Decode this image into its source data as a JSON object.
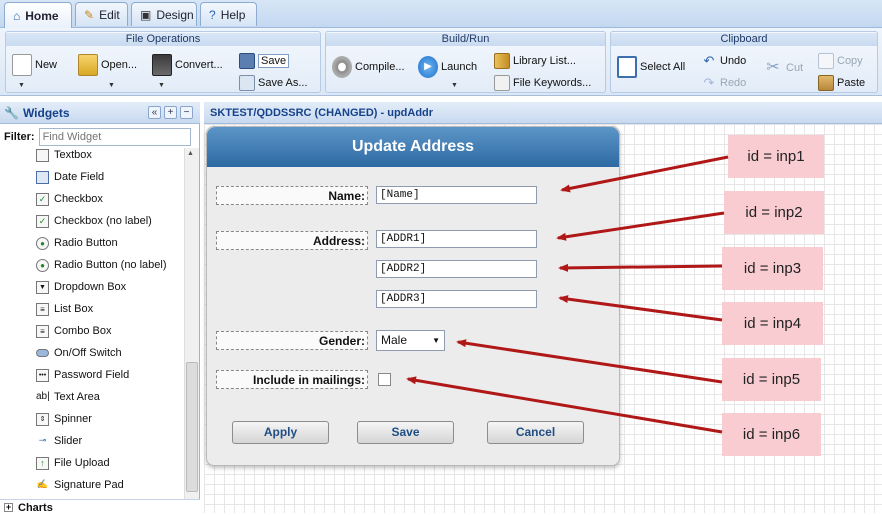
{
  "tabs": [
    {
      "label": "Home"
    },
    {
      "label": "Edit"
    },
    {
      "label": "Design"
    },
    {
      "label": "Help"
    }
  ],
  "ribbon": {
    "file_ops": {
      "title": "File Operations",
      "new": "New",
      "open": "Open...",
      "convert": "Convert...",
      "save": "Save",
      "save_as": "Save As..."
    },
    "build_run": {
      "title": "Build/Run",
      "compile": "Compile...",
      "launch": "Launch",
      "library_list": "Library List...",
      "file_keywords": "File Keywords..."
    },
    "clipboard": {
      "title": "Clipboard",
      "select_all": "Select All",
      "undo": "Undo",
      "redo": "Redo",
      "cut": "Cut",
      "copy": "Copy",
      "paste": "Paste"
    }
  },
  "sidebar": {
    "title": "Widgets",
    "filter_label": "Filter:",
    "filter_placeholder": "Find Widget",
    "items": [
      {
        "label": "Textbox"
      },
      {
        "label": "Date Field"
      },
      {
        "label": "Checkbox"
      },
      {
        "label": "Checkbox (no label)"
      },
      {
        "label": "Radio Button"
      },
      {
        "label": "Radio Button (no label)"
      },
      {
        "label": "Dropdown Box"
      },
      {
        "label": "List Box"
      },
      {
        "label": "Combo Box"
      },
      {
        "label": "On/Off Switch"
      },
      {
        "label": "Password Field"
      },
      {
        "label": "Text Area"
      },
      {
        "label": "Spinner"
      },
      {
        "label": "Slider"
      },
      {
        "label": "File Upload"
      },
      {
        "label": "Signature Pad"
      }
    ],
    "charts_label": "Charts"
  },
  "canvas": {
    "title": "SKTEST/QDDSSRC (CHANGED) - updAddr"
  },
  "dialog": {
    "title": "Update Address",
    "name_label": "Name:",
    "name_value": "[Name]",
    "address_label": "Address:",
    "addr1": "[ADDR1]",
    "addr2": "[ADDR2]",
    "addr3": "[ADDR3]",
    "gender_label": "Gender:",
    "gender_value": "Male",
    "mailings_label": "Include in mailings:",
    "apply": "Apply",
    "save": "Save",
    "cancel": "Cancel"
  },
  "callouts": [
    {
      "label": "id = inp1"
    },
    {
      "label": "id = inp2"
    },
    {
      "label": "id = inp3"
    },
    {
      "label": "id = inp4"
    },
    {
      "label": "id = inp5"
    },
    {
      "label": "id = inp6"
    }
  ],
  "colors": {
    "accent": "#15428b",
    "dialog_title": "#2e6aa3",
    "callout_bg": "#f8ccd0",
    "arrow": "#b01818"
  }
}
